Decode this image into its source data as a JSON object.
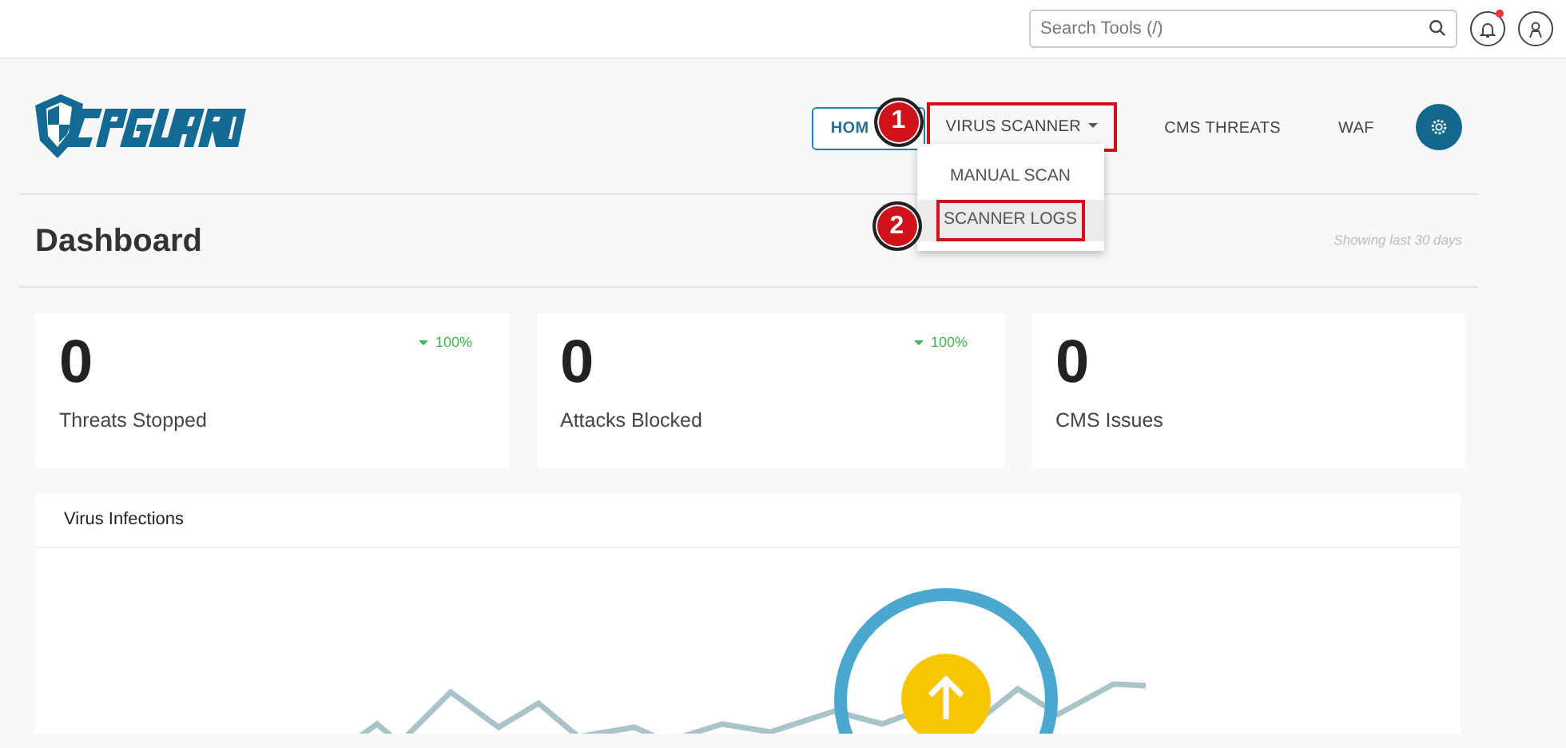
{
  "topbar": {
    "search": {
      "placeholder": "Search Tools (/)"
    },
    "notifications": {
      "unread": true
    }
  },
  "nav": {
    "items": [
      {
        "kind": "button",
        "label": "HOM",
        "selected": true
      },
      {
        "kind": "dropdown",
        "label": "VIRUS SCANNER",
        "selected": false,
        "expanded": true,
        "menu": [
          {
            "label": "MANUAL SCAN",
            "selected": false
          },
          {
            "label": "SCANNER LOGS",
            "selected": true
          }
        ]
      },
      {
        "kind": "link",
        "label": "CMS THREATS",
        "selected": false
      },
      {
        "kind": "link",
        "label": "WAF",
        "selected": false
      }
    ]
  },
  "callouts": [
    {
      "number": "1"
    },
    {
      "number": "2"
    }
  ],
  "page": {
    "title": "Dashboard",
    "range": "Showing last 30 days"
  },
  "stats": [
    {
      "value": "0",
      "label": "Threats Stopped",
      "trend": "100%"
    },
    {
      "value": "0",
      "label": "Attacks Blocked",
      "trend": "100%"
    },
    {
      "value": "0",
      "label": "CMS Issues"
    }
  ],
  "panel": {
    "title": "Virus Infections"
  }
}
